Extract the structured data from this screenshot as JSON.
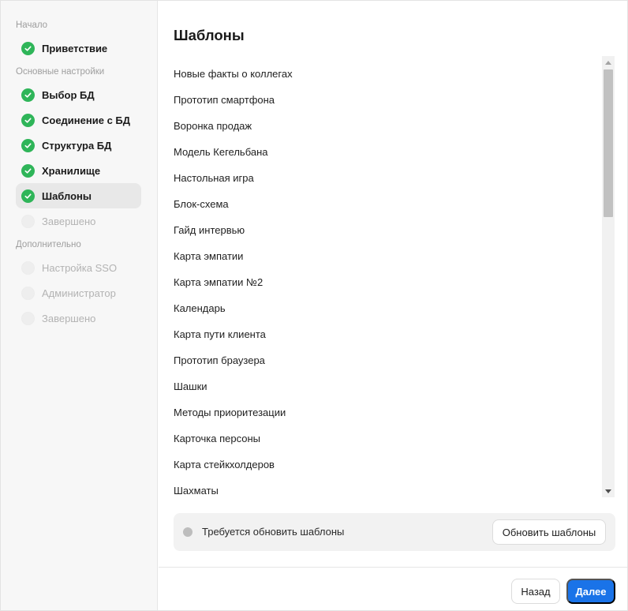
{
  "sidebar": {
    "sections": [
      {
        "title": "Начало"
      },
      {
        "title": "Основные настройки"
      },
      {
        "title": "Дополнительно"
      }
    ],
    "steps": [
      {
        "label": "Приветствие",
        "status": "done"
      },
      {
        "label": "Выбор БД",
        "status": "done"
      },
      {
        "label": "Соединение с БД",
        "status": "done"
      },
      {
        "label": "Структура БД",
        "status": "done"
      },
      {
        "label": "Хранилище",
        "status": "done"
      },
      {
        "label": "Шаблоны",
        "status": "current"
      },
      {
        "label": "Завершено",
        "status": "pending"
      },
      {
        "label": "Настройка SSO",
        "status": "pending"
      },
      {
        "label": "Администратор",
        "status": "pending"
      },
      {
        "label": "Завершено",
        "status": "pending"
      }
    ]
  },
  "main": {
    "title": "Шаблоны",
    "templates": [
      "Новые факты о коллегах",
      "Прототип смартфона",
      "Воронка продаж",
      "Модель Кегельбана",
      "Настольная игра",
      "Блок-схема",
      "Гайд интервью",
      "Карта эмпатии",
      "Карта эмпатии №2",
      "Календарь",
      "Карта пути клиента",
      "Прототип браузера",
      "Шашки",
      "Методы приоритезации",
      "Карточка персоны",
      "Карта стейкхолдеров",
      "Шахматы"
    ],
    "notice": {
      "text": "Требуется обновить шаблоны",
      "button": "Обновить шаблоны"
    }
  },
  "footer": {
    "back": "Назад",
    "next": "Далее"
  },
  "colors": {
    "success": "#2fb559",
    "primary": "#1a73e8",
    "status_dot": "#bdbdbd"
  },
  "icons": {
    "step_done": "check-circle-icon",
    "step_pending": "empty-circle-icon",
    "notice": "status-dot-icon"
  }
}
